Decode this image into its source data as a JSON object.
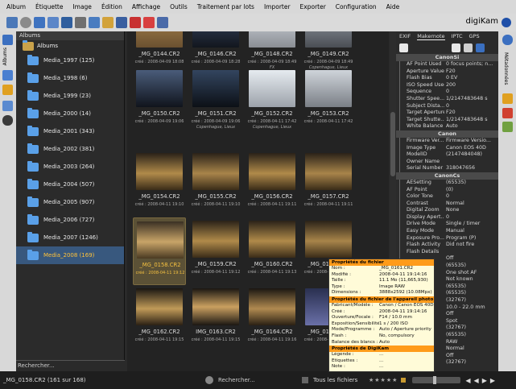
{
  "menu": [
    "Album",
    "Étiquette",
    "Image",
    "Édition",
    "Affichage",
    "Outils",
    "Traitement par lots",
    "Importer",
    "Exporter",
    "Configuration",
    "Aide"
  ],
  "brand": "digiKam",
  "left_tab_label": "Albums",
  "albums": {
    "header": "Albums",
    "root": "Albums",
    "items": [
      {
        "label": "Media_1997 (125)"
      },
      {
        "label": "Media_1998 (6)"
      },
      {
        "label": "Media_1999 (23)"
      },
      {
        "label": "Media_2000 (14)"
      },
      {
        "label": "Media_2001 (343)"
      },
      {
        "label": "Media_2002 (381)"
      },
      {
        "label": "Media_2003 (264)"
      },
      {
        "label": "Media_2004 (507)"
      },
      {
        "label": "Media_2005 (907)"
      },
      {
        "label": "Media_2006 (727)"
      },
      {
        "label": "Media_2007 (1246)"
      },
      {
        "label": "Media_2008 (169)"
      }
    ],
    "search_placeholder": "Rechercher..."
  },
  "thumbnails": [
    {
      "name": "_MG_0144.CR2",
      "date": "créé : 2008-04-09 18:08",
      "loc": ""
    },
    {
      "name": "_MG_0146.CR2",
      "date": "créé : 2008-04-09 18:28",
      "loc": ""
    },
    {
      "name": "_MG_0148.CR2",
      "date": "créé : 2008-04-09 18:49",
      "loc": "FX"
    },
    {
      "name": "_MG_0149.CR2",
      "date": "créé : 2008-04-09 18:49",
      "loc": "Copenhague, Lieux"
    },
    {
      "name": "_MG_0150.CR2",
      "date": "créé : 2008-04-09 19:06",
      "loc": ""
    },
    {
      "name": "_MG_0151.CR2",
      "date": "créé : 2008-04-09 19:06",
      "loc": "Copenhague, Lieux"
    },
    {
      "name": "_MG_0152.CR2",
      "date": "créé : 2008-04-11 17:42",
      "loc": "Copenhague, Lieux"
    },
    {
      "name": "_MG_0153.CR2",
      "date": "créé : 2008-04-11 17:42",
      "loc": ""
    },
    {
      "name": "_MG_0154.CR2",
      "date": "créé : 2008-04-11 19:10",
      "loc": ""
    },
    {
      "name": "_MG_0155.CR2",
      "date": "créé : 2008-04-11 19:10",
      "loc": ""
    },
    {
      "name": "_MG_0156.CR2",
      "date": "créé : 2008-04-11 19:11",
      "loc": ""
    },
    {
      "name": "_MG_0157.CR2",
      "date": "créé : 2008-04-11 19:11",
      "loc": ""
    },
    {
      "name": "_MG_0158.CR2",
      "date": "créé : 2008-04-11 19:12",
      "loc": ""
    },
    {
      "name": "_MG_0159.CR2",
      "date": "créé : 2008-04-11 19:12",
      "loc": ""
    },
    {
      "name": "_MG_0160.CR2",
      "date": "créé : 2008-04-11 19:13",
      "loc": ""
    },
    {
      "name": "_MG_0161.CR2",
      "date": "créé : 2008-04-11 19:14",
      "loc": ""
    },
    {
      "name": "_MG_0162.CR2",
      "date": "créé : 2008-04-11 19:15",
      "loc": ""
    },
    {
      "name": "IMG_0163.CR2",
      "date": "créé : 2008-04-11 19:15",
      "loc": ""
    },
    {
      "name": "_MG_0164.CR2",
      "date": "créé : 2008-04-11 19:16",
      "loc": ""
    },
    {
      "name": "_MG_0165.CR2",
      "date": "créé : 2008-04-11 19:16",
      "loc": ""
    }
  ],
  "metadata": {
    "tabs": [
      "EXIF",
      "Makernote",
      "IPTC",
      "GPS"
    ],
    "sections": [
      {
        "title": "CanonSi",
        "rows": [
          [
            "AF Point Used",
            "0 focus points; n..."
          ],
          [
            "Aperture Value",
            "F20"
          ],
          [
            "Flash Bias",
            "0 EV"
          ],
          [
            "ISO Speed Used",
            "200"
          ],
          [
            "Sequence",
            "0"
          ],
          [
            "Shutter Spee...",
            "1/2147483648 s"
          ],
          [
            "Subject Dista...",
            "0"
          ],
          [
            "Target Aperture",
            "F20"
          ],
          [
            "Target Shutte...",
            "1/2147483648 s"
          ],
          [
            "White Balance",
            "Auto"
          ]
        ]
      },
      {
        "title": "Canon",
        "rows": [
          [
            "Firmware Ver...",
            "Firmware Versio..."
          ],
          [
            "Image Type",
            "Canon EOS 40D"
          ],
          [
            "ModelID",
            "(2147484048)"
          ],
          [
            "Owner Name",
            ""
          ],
          [
            "Serial Number",
            "318047656"
          ]
        ]
      },
      {
        "title": "CanonCs",
        "rows": [
          [
            "AESetting",
            "(65535)"
          ],
          [
            "AF Point",
            "(0)"
          ],
          [
            "Color Tone",
            "0"
          ],
          [
            "Contrast",
            "Normal"
          ],
          [
            "Digital Zoom",
            "None"
          ],
          [
            "Display Apert...",
            "0"
          ],
          [
            "Drive Mode",
            "Single / timer"
          ],
          [
            "Easy Mode",
            "Manual"
          ],
          [
            "Exposure Pro...",
            "Program (P)"
          ],
          [
            "Flash Activity",
            "Did not fire"
          ],
          [
            "Flash Details",
            ""
          ],
          [
            "",
            "Off"
          ],
          [
            "",
            "(65535)"
          ],
          [
            "",
            "One shot AF"
          ],
          [
            "",
            "Not known"
          ],
          [
            "",
            "(65535)"
          ],
          [
            "",
            "(65535)"
          ],
          [
            "",
            "(32767)"
          ],
          [
            "",
            "10.0 - 22.0 mm"
          ],
          [
            "",
            "Off"
          ],
          [
            "ode",
            "Spot"
          ],
          [
            "",
            "(32767)"
          ],
          [
            "",
            "(65535)"
          ],
          [
            "",
            "RAW"
          ],
          [
            "",
            "Normal"
          ],
          [
            "",
            "Off"
          ],
          [
            "",
            "(32767)"
          ]
        ]
      }
    ]
  },
  "tooltip": {
    "s1": "Propriétés du fichier",
    "rows1": [
      [
        "Nom :",
        "_MG_0161.CR2"
      ],
      [
        "Modifié :",
        "2008-04-11 19:14:16"
      ],
      [
        "Taille :",
        "11.1 Mo (11,665,930)"
      ],
      [
        "Type :",
        "Image RAW"
      ],
      [
        "Dimensions :",
        "3888x2592 (10.08Mpx)"
      ]
    ],
    "s2": "Propriétés du fichier de l'appareil photo",
    "rows2": [
      [
        "Fabricant/Modèle :",
        "Canon / Canon EOS 40D"
      ],
      [
        "Créé :",
        "2008-04-11 19:14:16"
      ],
      [
        "Ouverture/Focale :",
        "F14 / 10.0 mm"
      ],
      [
        "Exposition/Sensibilité :",
        "1 s / 200 ISO"
      ],
      [
        "Mode/Programme :",
        "Auto / Aperture priority"
      ],
      [
        "Flash :",
        "No, compulsory"
      ],
      [
        "Balance des blancs :",
        "Auto"
      ]
    ],
    "s3": "Propriétés de DigiKam",
    "rows3": [
      [
        "Légende :",
        "..."
      ],
      [
        "Étiquettes :",
        "..."
      ],
      [
        "Note :",
        "..."
      ]
    ]
  },
  "status": {
    "left": "_MG_0158.CR2 (161 sur 168)",
    "search_placeholder": "Rechercher...",
    "filter": "Tous les fichiers"
  }
}
